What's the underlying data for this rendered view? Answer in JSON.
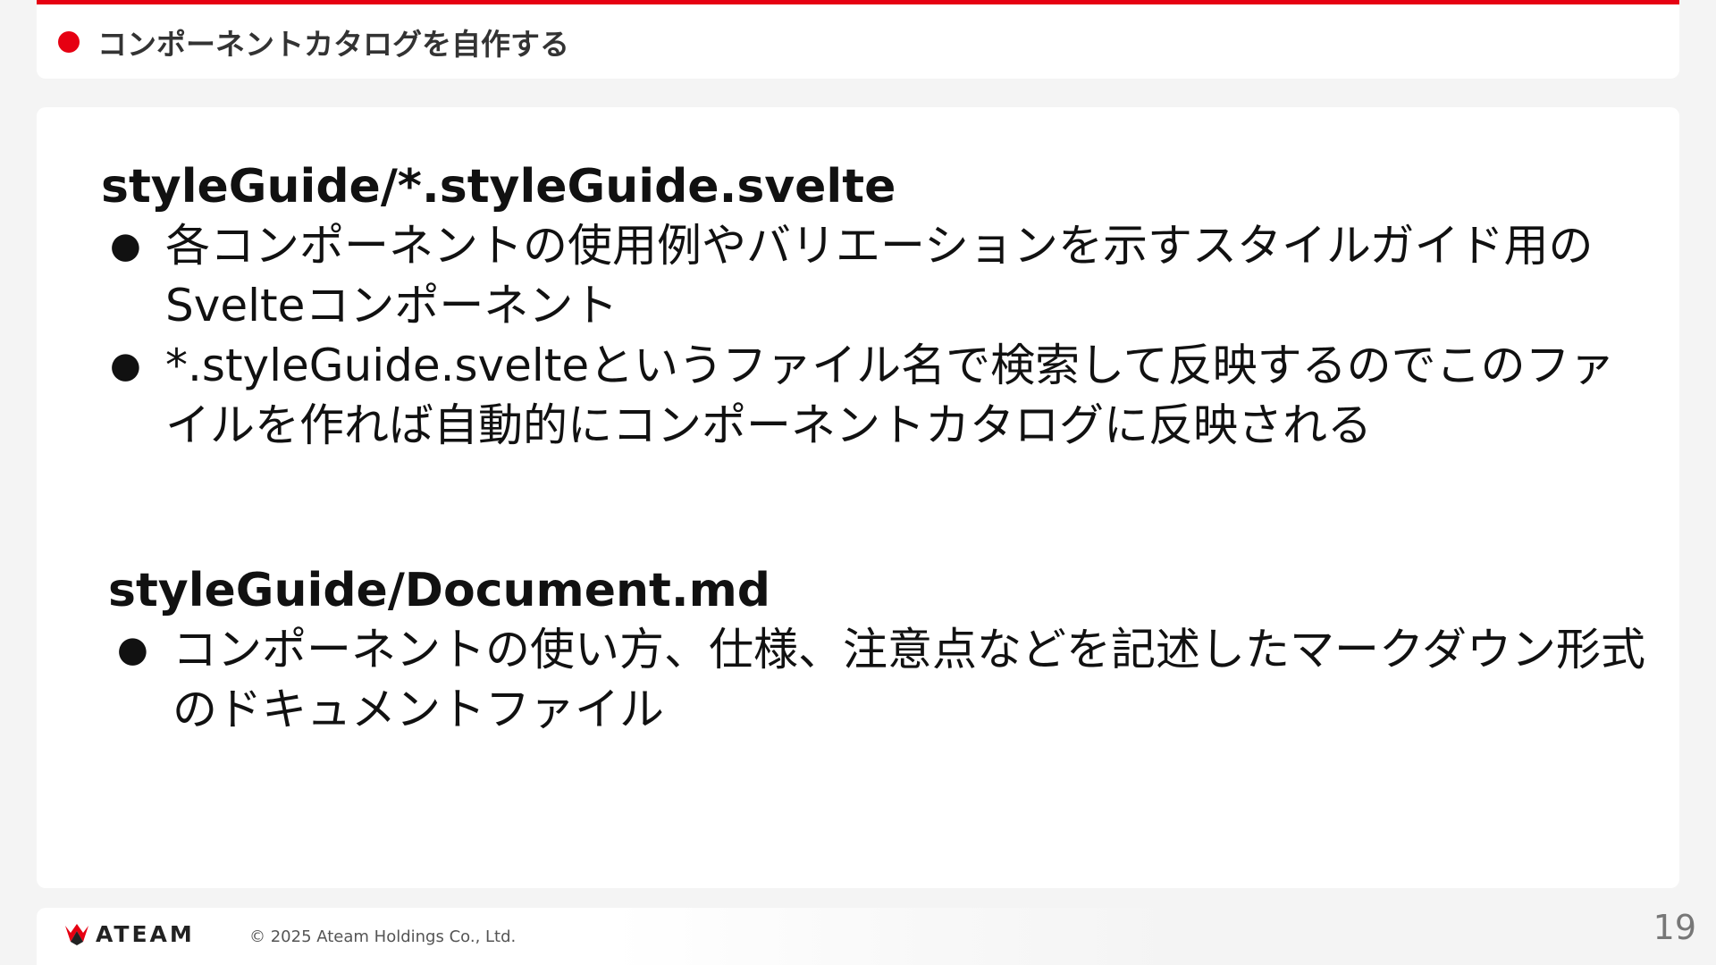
{
  "header": {
    "title": "コンポーネントカタログを自作する"
  },
  "sections": [
    {
      "heading": "styleGuide/*.styleGuide.svelte",
      "bullets": [
        {
          "mark": "●",
          "text": "各コンポーネントの使用例やバリエーションを示すスタイルガイド用のSvelteコンポーネント"
        },
        {
          "mark": "●",
          "text": "*.styleGuide.svelteというファイル名で検索して反映するのでこのファイルを作れば自動的にコンポーネントカタログに反映される"
        }
      ]
    },
    {
      "heading": "styleGuide/Document.md",
      "bullets": [
        {
          "mark": "●",
          "text": "コンポーネントの使い方、仕様、注意点などを記述したマークダウン形式のドキュメントファイル"
        }
      ]
    }
  ],
  "footer": {
    "logo_text": "ATEAM",
    "logo_icon": "ateam-logo-icon",
    "copyright": "© 2025 Ateam Holdings Co., Ltd."
  },
  "page_number": "19",
  "colors": {
    "accent": "#e60012",
    "background": "#f4f4f4",
    "card": "#ffffff"
  }
}
